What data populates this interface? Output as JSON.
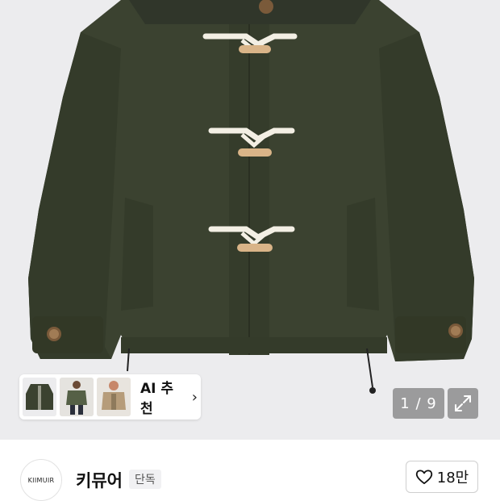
{
  "gallery": {
    "image_alt": "Olive green duffle-style short padded jacket with cream rope toggles",
    "counter": "1 / 9",
    "expand_icon": "expand-arrows-icon"
  },
  "ai_recommend": {
    "label": "AI 추천",
    "chevron": "›",
    "thumbnails": [
      "jacket-front",
      "model-green-jacket",
      "model-beige-jacket"
    ]
  },
  "brand": {
    "logo_text": "KIIMUIR",
    "name": "키뮤어",
    "badge": "단독"
  },
  "like": {
    "icon": "heart-outline-icon",
    "count": "18만"
  },
  "colors": {
    "jacket": "#3b4230",
    "toggle_rope": "#f3efe4",
    "toggle_wood": "#d9b488",
    "background": "#ececee"
  }
}
